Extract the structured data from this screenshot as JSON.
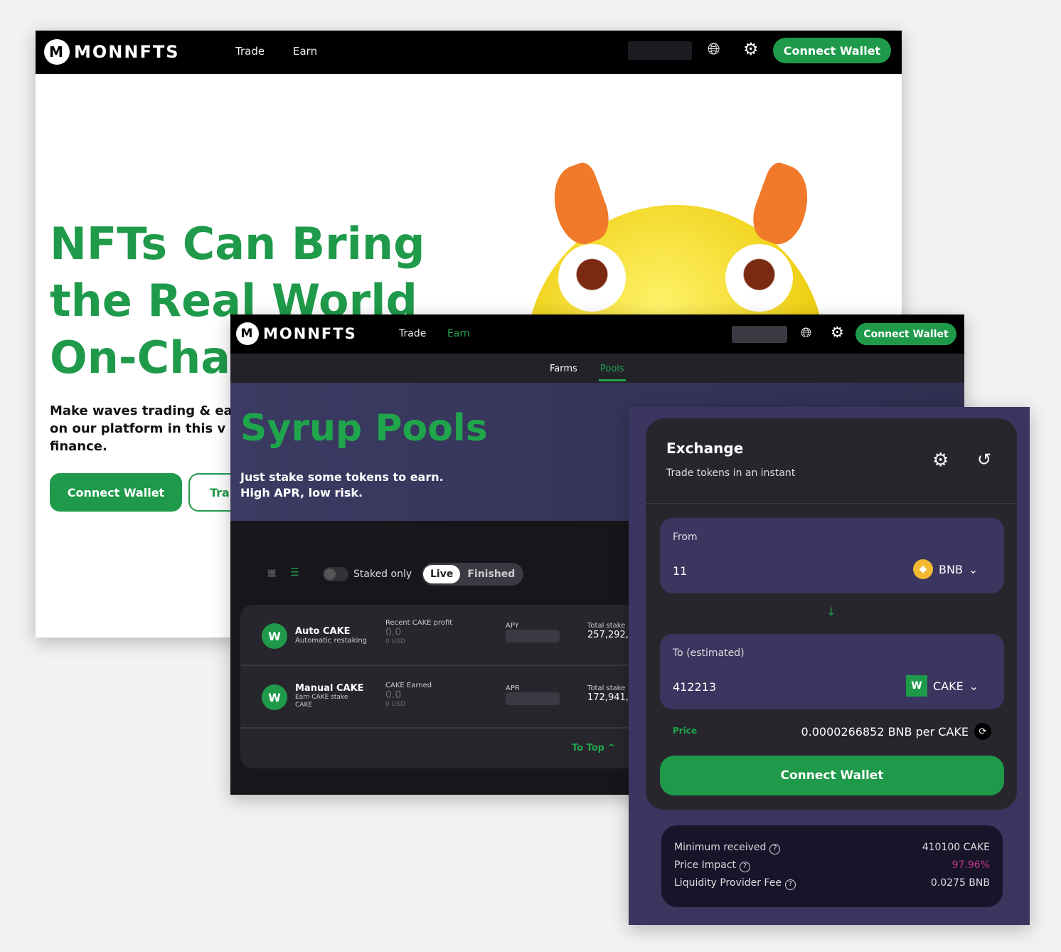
{
  "brand": "MONNFTS",
  "colors": {
    "accent": "#1f9a4a",
    "pool_banner": "#3b3a62",
    "exchange_bg": "#3a3660",
    "impact": "#c2338a"
  },
  "landing": {
    "nav": {
      "trade": "Trade",
      "earn": "Earn",
      "connect": "Connect Wallet"
    },
    "hero": {
      "line1": "NFTs Can Bring",
      "line2": "the Real World",
      "line3": "On-Cha",
      "sub1": "Make waves trading & ea",
      "sub2": "on our platform in this v",
      "sub3": "finance.",
      "connect": "Connect Wallet",
      "trade": "Tra"
    }
  },
  "pools": {
    "nav": {
      "trade": "Trade",
      "earn": "Earn",
      "connect": "Connect Wallet"
    },
    "tabs": {
      "farms": "Farms",
      "pools": "Pools"
    },
    "banner": {
      "title": "Syrup Pools",
      "sub1": "Just stake some tokens to earn.",
      "sub2": "High APR, low risk."
    },
    "filters": {
      "staked_only": "Staked only",
      "staked_only_on": false,
      "live": "Live",
      "finished": "Finished"
    },
    "rows": [
      {
        "name": "Auto CAKE",
        "desc": "Automatic restaking",
        "earn_label": "Recent CAKE profit",
        "earn_value": "0.0",
        "earn_usd": "0 USD",
        "rate_label": "APY",
        "total_label": "Total stake",
        "total_value": "257,292,5"
      },
      {
        "name": "Manual CAKE",
        "desc": "Earn CAKE stake CAKE",
        "earn_label": "CAKE Earned",
        "earn_value": "0.0",
        "earn_usd": "0 USD",
        "rate_label": "APR",
        "total_label": "Total stake",
        "total_value": "172,941,0"
      }
    ],
    "to_top": "To Top ^"
  },
  "exchange": {
    "title": "Exchange",
    "subtitle": "Trade tokens in an instant",
    "from": {
      "label": "From",
      "value": "11",
      "token": "BNB"
    },
    "to": {
      "label": "To (estimated)",
      "value": "412213",
      "token": "CAKE"
    },
    "price_label": "Price",
    "price_value": "0.0000266852 BNB per CAKE",
    "connect": "Connect Wallet",
    "details": [
      {
        "label": "Minimum received",
        "value": "410100 CAKE"
      },
      {
        "label": "Price Impact",
        "value": "97.96%"
      },
      {
        "label": "Liquidity Provider Fee",
        "value": "0.0275 BNB"
      }
    ]
  }
}
